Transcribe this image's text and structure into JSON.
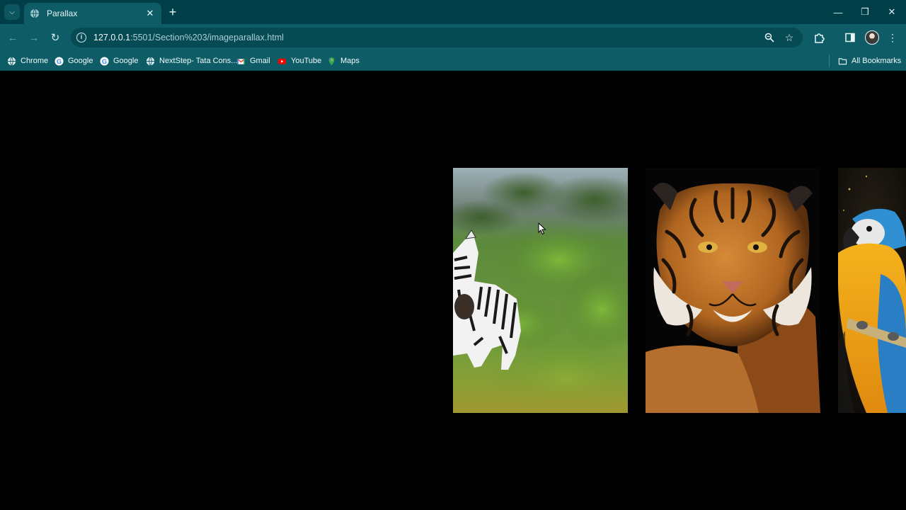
{
  "browser": {
    "tab": {
      "title": "Parallax"
    },
    "url": {
      "host": "127.0.0.1",
      "rest": ":5501/Section%203/imageparallax.html"
    },
    "bookmarks": [
      {
        "label": "Chrome",
        "icon": "globe-icon"
      },
      {
        "label": "Google",
        "icon": "google-icon"
      },
      {
        "label": "Google",
        "icon": "google-icon"
      },
      {
        "label": "NextStep- Tata Cons...",
        "icon": "globe-icon"
      },
      {
        "label": "Gmail",
        "icon": "gmail-icon"
      },
      {
        "label": "YouTube",
        "icon": "youtube-icon"
      },
      {
        "label": "Maps",
        "icon": "maps-icon"
      }
    ],
    "all_bookmarks": "All Bookmarks"
  },
  "page": {
    "images": [
      {
        "subject": "zebra-in-grass",
        "icon": "zebra-image"
      },
      {
        "subject": "tiger",
        "icon": "tiger-image"
      },
      {
        "subject": "macaw-parrot",
        "icon": "parrot-image"
      }
    ]
  },
  "colors": {
    "frame": "#003e48",
    "toolbar": "#0e5d66",
    "page_background": "#000000"
  }
}
